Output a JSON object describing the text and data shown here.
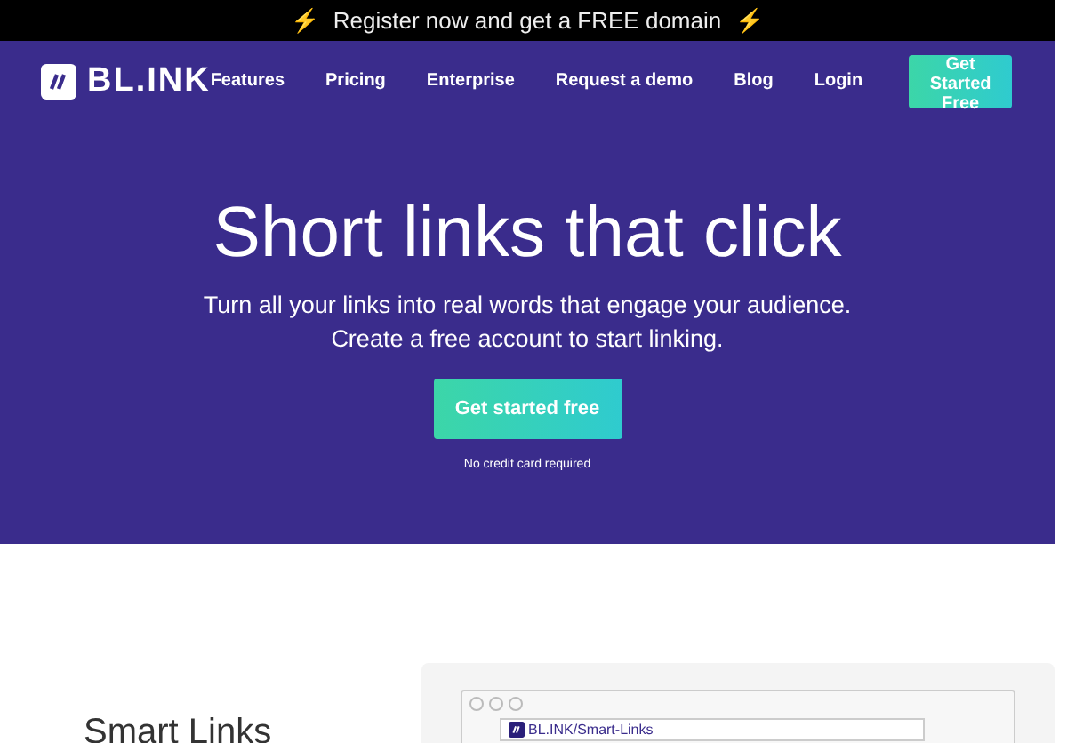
{
  "announcement": {
    "icon_left": "⚡",
    "text": "Register now and get a FREE domain",
    "icon_right": "⚡"
  },
  "nav": {
    "logo": "BL.INK",
    "links": [
      "Features",
      "Pricing",
      "Enterprise",
      "Request a demo",
      "Blog",
      "Login"
    ],
    "cta": "Get Started Free"
  },
  "hero": {
    "title": "Short links that click",
    "subtitle_lines": [
      "Turn all your links into real words that engage your audience.",
      "Create a free account to start linking."
    ],
    "button": "Get started free",
    "note": "No credit card required"
  },
  "feature": {
    "heading": "Smart Links",
    "browser_url": "BL.INK/Smart-Links"
  }
}
